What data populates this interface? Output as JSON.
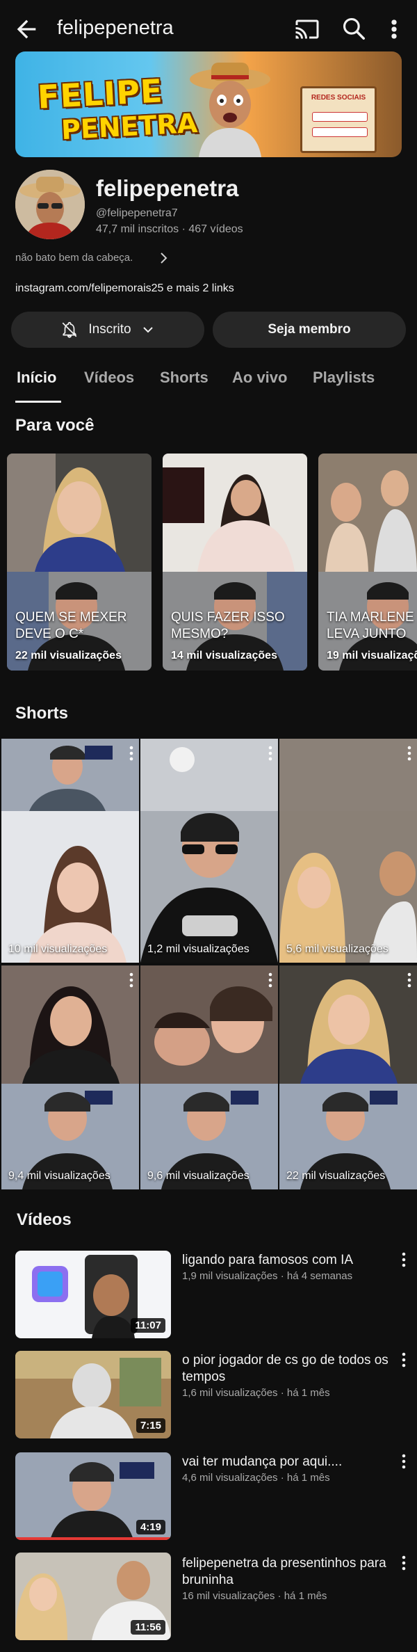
{
  "topbar": {
    "title": "felipepenetra"
  },
  "banner": {
    "logo_line1": "FELIPE",
    "logo_line2": "PENETRA",
    "sign_title": "REDES SOCIAIS"
  },
  "channel": {
    "name": "felipepenetra",
    "handle": "@felipepenetra7",
    "stats": "47,7 mil inscritos · 467 vídeos",
    "description": "não bato bem da cabeça.",
    "links": "instagram.com/felipemorais25 e mais 2 links",
    "subscribe_label": "Inscrito",
    "member_label": "Seja membro"
  },
  "tabs": [
    "Início",
    "Vídeos",
    "Shorts",
    "Ao vivo",
    "Playlists"
  ],
  "for_you": {
    "title": "Para você",
    "items": [
      {
        "caption_l1": "QUEM SE MEXER",
        "caption_l2": "DEVE O C*",
        "views": "22 mil visualizações"
      },
      {
        "caption_l1": "QUIS FAZER ISSO",
        "caption_l2": "MESMO?",
        "views": "14 mil visualizações"
      },
      {
        "caption_l1": "TIA MARLENE",
        "caption_l2": "LEVA JUNTO",
        "views": "19 mil visualizações"
      }
    ]
  },
  "shorts": {
    "title": "Shorts",
    "items": [
      {
        "views": "10 mil visualizações"
      },
      {
        "views": "1,2 mil visualizações"
      },
      {
        "views": "5,6 mil visualizações"
      },
      {
        "views": "9,4 mil visualizações"
      },
      {
        "views": "9,6 mil visualizações"
      },
      {
        "views": "22 mil visualizações"
      }
    ]
  },
  "videos": {
    "title": "Vídeos",
    "items": [
      {
        "title": "ligando para famosos com IA",
        "meta": "1,9 mil visualizações · há 4 semanas",
        "duration": "11:07"
      },
      {
        "title": "o pior jogador de cs go de todos os tempos",
        "meta": "1,6 mil visualizações · há 1 mês",
        "duration": "7:15"
      },
      {
        "title": "vai ter mudança por aqui....",
        "meta": "4,6 mil visualizações · há 1 mês",
        "duration": "4:19"
      },
      {
        "title": "felipepenetra da presentinhos para bruninha",
        "meta": "16 mil visualizações · há 1 mês",
        "duration": "11:56"
      }
    ]
  },
  "colors": {
    "background": "#0f0f0f",
    "button": "#272727",
    "text_primary": "#f1f1f1",
    "text_secondary": "#aaaaaa"
  },
  "icons": [
    "back-arrow-icon",
    "cast-icon",
    "search-icon",
    "more-vert-icon",
    "bell-off-icon",
    "chevron-down-icon",
    "chevron-right-icon"
  ]
}
